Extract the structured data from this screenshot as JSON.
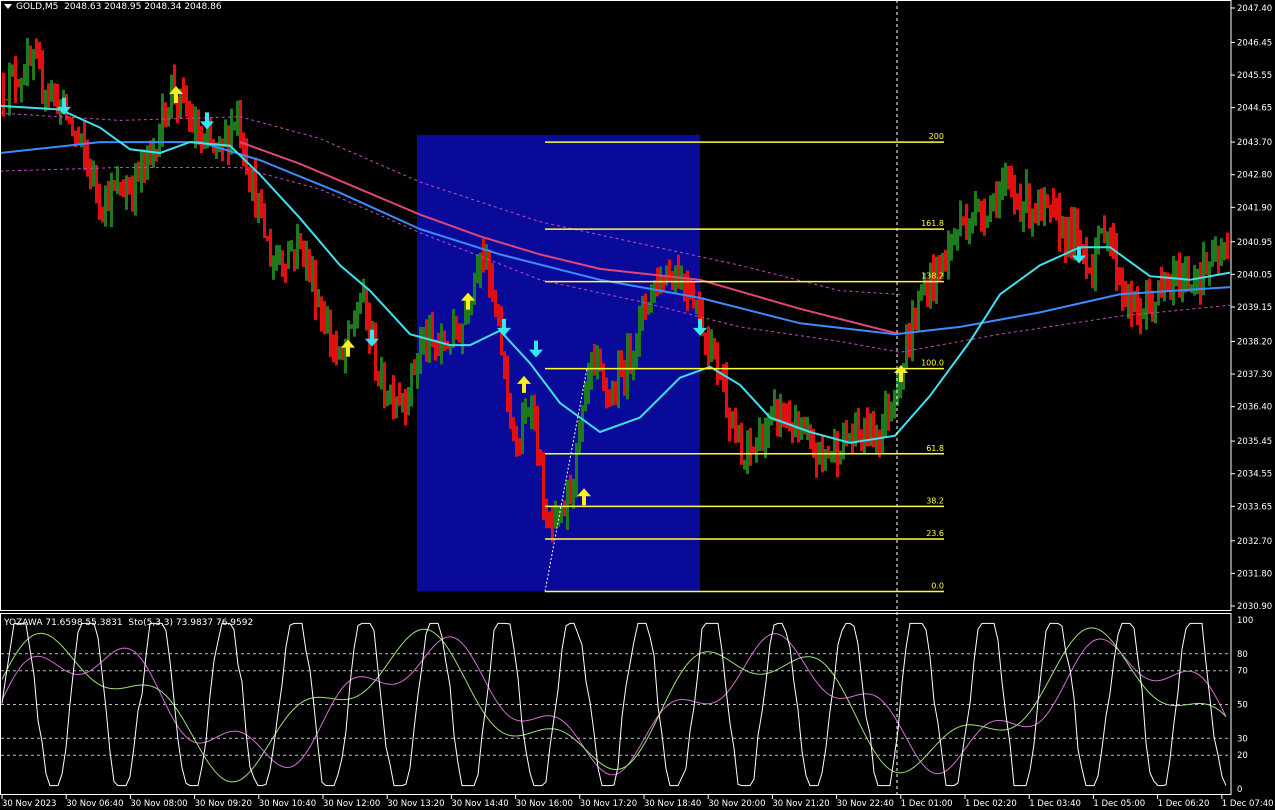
{
  "header": {
    "symbol": "GOLD,M5",
    "ohlc": "2048.63 2048.95 2048.34 2048.86"
  },
  "subwindow_header": {
    "indicator": "YOZAWA 71.6598 55.3831",
    "stochastic": "Sto(5,3,3) 73.9837 76.9592"
  },
  "colors": {
    "background": "#000000",
    "bull": "#1f7a1f",
    "bear": "#e01010",
    "fast_ma": "#40e0f0",
    "slow_ma": "#3a8cff",
    "trend_ma": "#e0457a",
    "band": "#c04ac0",
    "fib": "#ffff33",
    "box": "#0a0a9a",
    "buy_arrow": "#ffee22",
    "sell_arrow": "#33e8f0",
    "osc_main": "#ffffff",
    "sto_main": "#9be07a",
    "sto_signal": "#d070d0"
  },
  "chart_data": {
    "type": "candlestick",
    "price_axis": {
      "ylim": [
        2030.9,
        2047.4
      ],
      "ticks": [
        "2047.40",
        "2046.45",
        "2045.55",
        "2044.65",
        "2043.70",
        "2042.80",
        "2041.90",
        "2040.95",
        "2040.05",
        "2039.15",
        "2038.20",
        "2037.30",
        "2036.40",
        "2035.45",
        "2034.55",
        "2033.65",
        "2032.70",
        "2031.80",
        "2030.90"
      ]
    },
    "time_axis": {
      "ticks": [
        "30 Nov 2023",
        "30 Nov 06:40",
        "30 Nov 08:00",
        "30 Nov 09:20",
        "30 Nov 10:40",
        "30 Nov 12:00",
        "30 Nov 13:20",
        "30 Nov 14:40",
        "30 Nov 16:00",
        "30 Nov 17:20",
        "30 Nov 18:40",
        "30 Nov 20:00",
        "30 Nov 21:20",
        "30 Nov 22:40",
        "1 Dec 01:00",
        "1 Dec 02:20",
        "1 Dec 03:40",
        "1 Dec 05:00",
        "1 Dec 06:20",
        "1 Dec 07:40"
      ]
    },
    "fibonacci": [
      {
        "label": "200",
        "price": 2043.7
      },
      {
        "label": "161.8",
        "price": 2041.3
      },
      {
        "label": "138.2",
        "price": 2039.85
      },
      {
        "label": "100.0",
        "price": 2037.45
      },
      {
        "label": "61.8",
        "price": 2035.1
      },
      {
        "label": "38.2",
        "price": 2033.65
      },
      {
        "label": "23.6",
        "price": 2032.75
      },
      {
        "label": "0.0",
        "price": 2031.3
      }
    ],
    "fast_ma_points": [
      [
        0,
        2044.7
      ],
      [
        60,
        2044.6
      ],
      [
        100,
        2044.1
      ],
      [
        130,
        2043.5
      ],
      [
        160,
        2043.4
      ],
      [
        190,
        2043.7
      ],
      [
        230,
        2043.6
      ],
      [
        260,
        2042.8
      ],
      [
        300,
        2041.6
      ],
      [
        340,
        2040.3
      ],
      [
        370,
        2039.6
      ],
      [
        410,
        2038.4
      ],
      [
        450,
        2038.1
      ],
      [
        470,
        2038.1
      ],
      [
        500,
        2038.5
      ],
      [
        530,
        2037.6
      ],
      [
        560,
        2036.5
      ],
      [
        600,
        2035.7
      ],
      [
        640,
        2036.1
      ],
      [
        680,
        2037.2
      ],
      [
        710,
        2037.5
      ],
      [
        740,
        2037.0
      ],
      [
        770,
        2036.1
      ],
      [
        810,
        2035.7
      ],
      [
        850,
        2035.4
      ],
      [
        895,
        2035.6
      ],
      [
        930,
        2036.7
      ],
      [
        970,
        2038.2
      ],
      [
        1000,
        2039.5
      ],
      [
        1040,
        2040.3
      ],
      [
        1080,
        2040.8
      ],
      [
        1110,
        2040.8
      ],
      [
        1150,
        2040.0
      ],
      [
        1190,
        2039.9
      ],
      [
        1230,
        2040.1
      ]
    ],
    "slow_ma_points": [
      [
        0,
        2043.4
      ],
      [
        100,
        2043.7
      ],
      [
        200,
        2043.7
      ],
      [
        260,
        2043.2
      ],
      [
        340,
        2042.3
      ],
      [
        420,
        2041.3
      ],
      [
        500,
        2040.6
      ],
      [
        600,
        2039.9
      ],
      [
        700,
        2039.4
      ],
      [
        800,
        2038.7
      ],
      [
        895,
        2038.4
      ],
      [
        960,
        2038.6
      ],
      [
        1040,
        2039.0
      ],
      [
        1120,
        2039.5
      ],
      [
        1230,
        2039.7
      ]
    ],
    "trend_ma_points": [
      [
        240,
        2043.7
      ],
      [
        300,
        2043.1
      ],
      [
        360,
        2042.4
      ],
      [
        420,
        2041.7
      ],
      [
        480,
        2041.1
      ],
      [
        540,
        2040.6
      ],
      [
        600,
        2040.2
      ],
      [
        700,
        2039.9
      ],
      [
        800,
        2039.1
      ],
      [
        900,
        2038.4
      ]
    ],
    "band_upper_points": [
      [
        0,
        2044.5
      ],
      [
        120,
        2044.3
      ],
      [
        240,
        2044.4
      ],
      [
        320,
        2043.8
      ],
      [
        420,
        2042.6
      ],
      [
        540,
        2041.5
      ],
      [
        640,
        2040.9
      ],
      [
        740,
        2040.3
      ],
      [
        840,
        2039.6
      ],
      [
        900,
        2039.5
      ]
    ],
    "band_lower_points": [
      [
        0,
        2042.9
      ],
      [
        120,
        2043.0
      ],
      [
        240,
        2043.0
      ],
      [
        320,
        2042.4
      ],
      [
        420,
        2041.2
      ],
      [
        540,
        2039.9
      ],
      [
        640,
        2039.3
      ],
      [
        740,
        2038.6
      ],
      [
        840,
        2038.2
      ],
      [
        900,
        2037.9
      ],
      [
        1000,
        2038.4
      ],
      [
        1120,
        2038.9
      ],
      [
        1230,
        2039.2
      ]
    ],
    "blue_box": {
      "x0": 417,
      "x1": 700,
      "price_top": 2043.9,
      "price_bottom": 2031.3
    },
    "buy_arrows": [
      [
        176,
        2045.0
      ],
      [
        348,
        2038.0
      ],
      [
        468,
        2039.3
      ],
      [
        524,
        2037.0
      ],
      [
        584,
        2033.9
      ],
      [
        901,
        2037.3
      ]
    ],
    "sell_arrows": [
      [
        64,
        2044.7
      ],
      [
        207,
        2044.3
      ],
      [
        372,
        2038.3
      ],
      [
        504,
        2038.6
      ],
      [
        536,
        2038.0
      ],
      [
        700,
        2038.6
      ],
      [
        1079,
        2040.6
      ]
    ],
    "oscillator_levels": [
      100,
      80,
      70,
      50,
      30,
      20,
      0
    ]
  }
}
